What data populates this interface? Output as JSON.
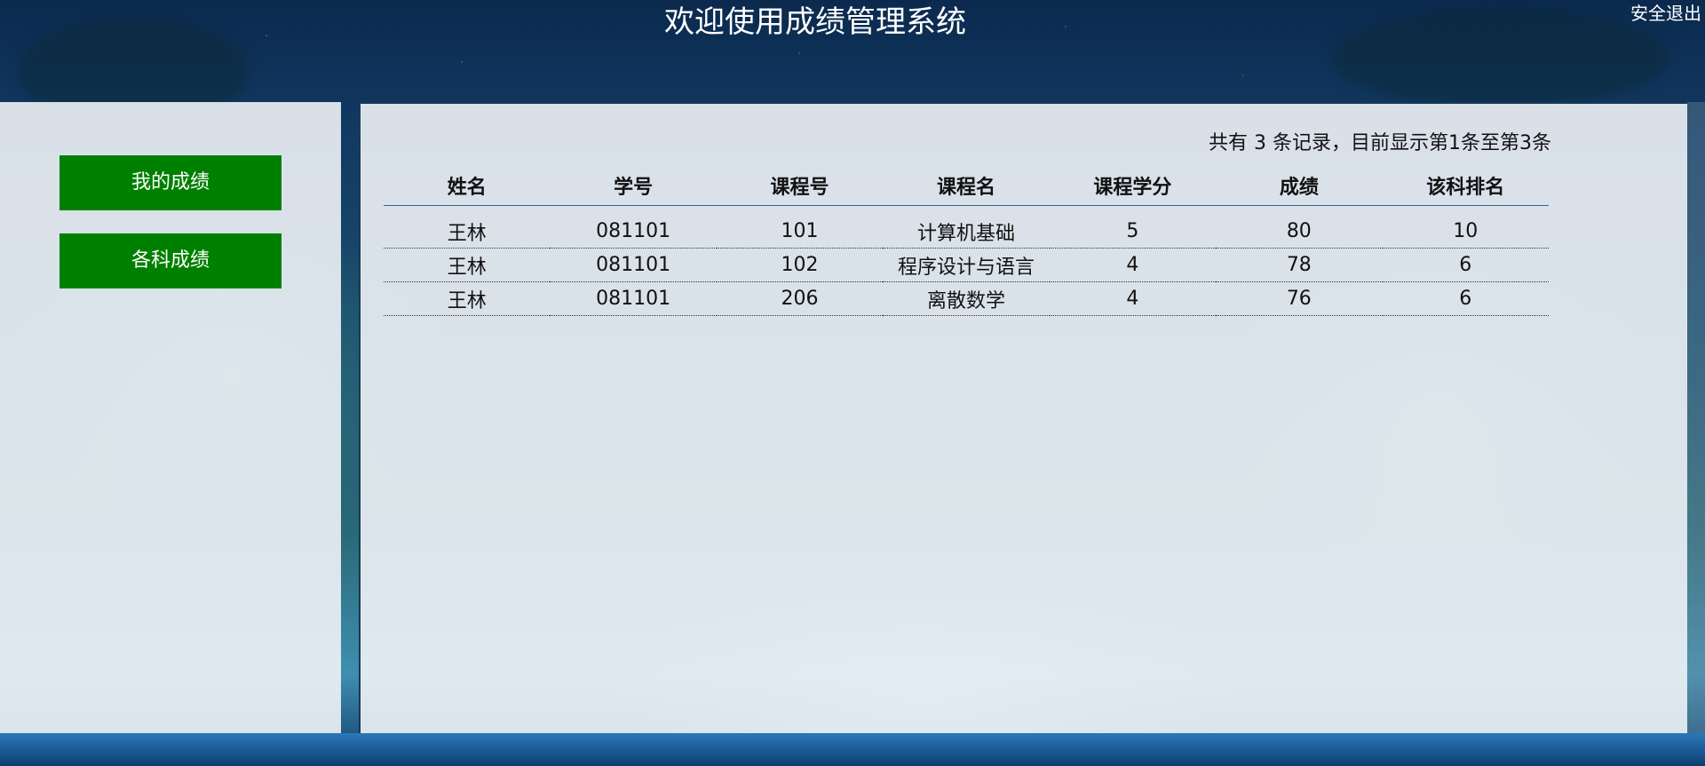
{
  "header": {
    "title": "欢迎使用成绩管理系统",
    "logout_label": "安全退出"
  },
  "sidebar": {
    "items": [
      {
        "label": "我的成绩"
      },
      {
        "label": "各科成绩"
      }
    ]
  },
  "main": {
    "summary": "共有 3 条记录，目前显示第1条至第3条",
    "table": {
      "columns": [
        "姓名",
        "学号",
        "课程号",
        "课程名",
        "课程学分",
        "成绩",
        "该科排名"
      ],
      "rows": [
        [
          "王林",
          "081101",
          "101",
          "计算机基础",
          "5",
          "80",
          "10"
        ],
        [
          "王林",
          "081101",
          "102",
          "程序设计与语言",
          "4",
          "78",
          "6"
        ],
        [
          "王林",
          "081101",
          "206",
          "离散数学",
          "4",
          "76",
          "6"
        ]
      ]
    }
  },
  "colors": {
    "nav_button_bg": "#008000",
    "panel_bg": "#f0f3f7",
    "header_text": "#ffffff",
    "table_rule": "#336699"
  }
}
